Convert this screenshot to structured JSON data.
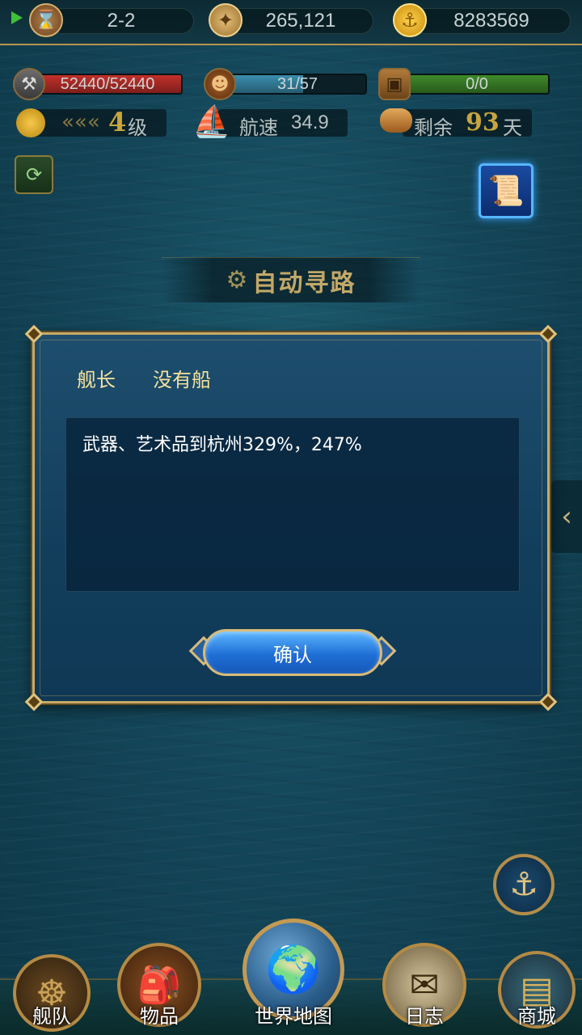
{
  "top": {
    "stage": "2-2",
    "compass_value": "265,121",
    "gold_value": "8283569"
  },
  "stats": {
    "durability": {
      "label": "52440/52440",
      "fill": 1.0,
      "color": "#c2302b"
    },
    "crew": {
      "label": "31/57",
      "fill": 0.54,
      "color": "#3a8eae"
    },
    "cargo": {
      "label": "0/0",
      "fill": 1.0,
      "color": "#3f8a2a"
    }
  },
  "info": {
    "level_num": "4",
    "level_unit": "级",
    "speed_label": "航速",
    "speed_value": "34.9",
    "remain_label": "剩余",
    "remain_days": "93",
    "remain_unit": "天"
  },
  "auto_path": {
    "title": "自动寻路"
  },
  "dialog": {
    "label_captain": "舰长",
    "label_ship": "没有船",
    "message": "武器、艺术品到杭州329%，247%",
    "confirm": "确认"
  },
  "nav": {
    "fleet": "舰队",
    "items": "物品",
    "world_map": "世界地图",
    "log": "日志",
    "shop": "商城"
  },
  "icons": {
    "hourglass": "hourglass-icon",
    "compass": "compass-icon",
    "coin": "coin-icon",
    "anchor": "anchor-icon"
  }
}
